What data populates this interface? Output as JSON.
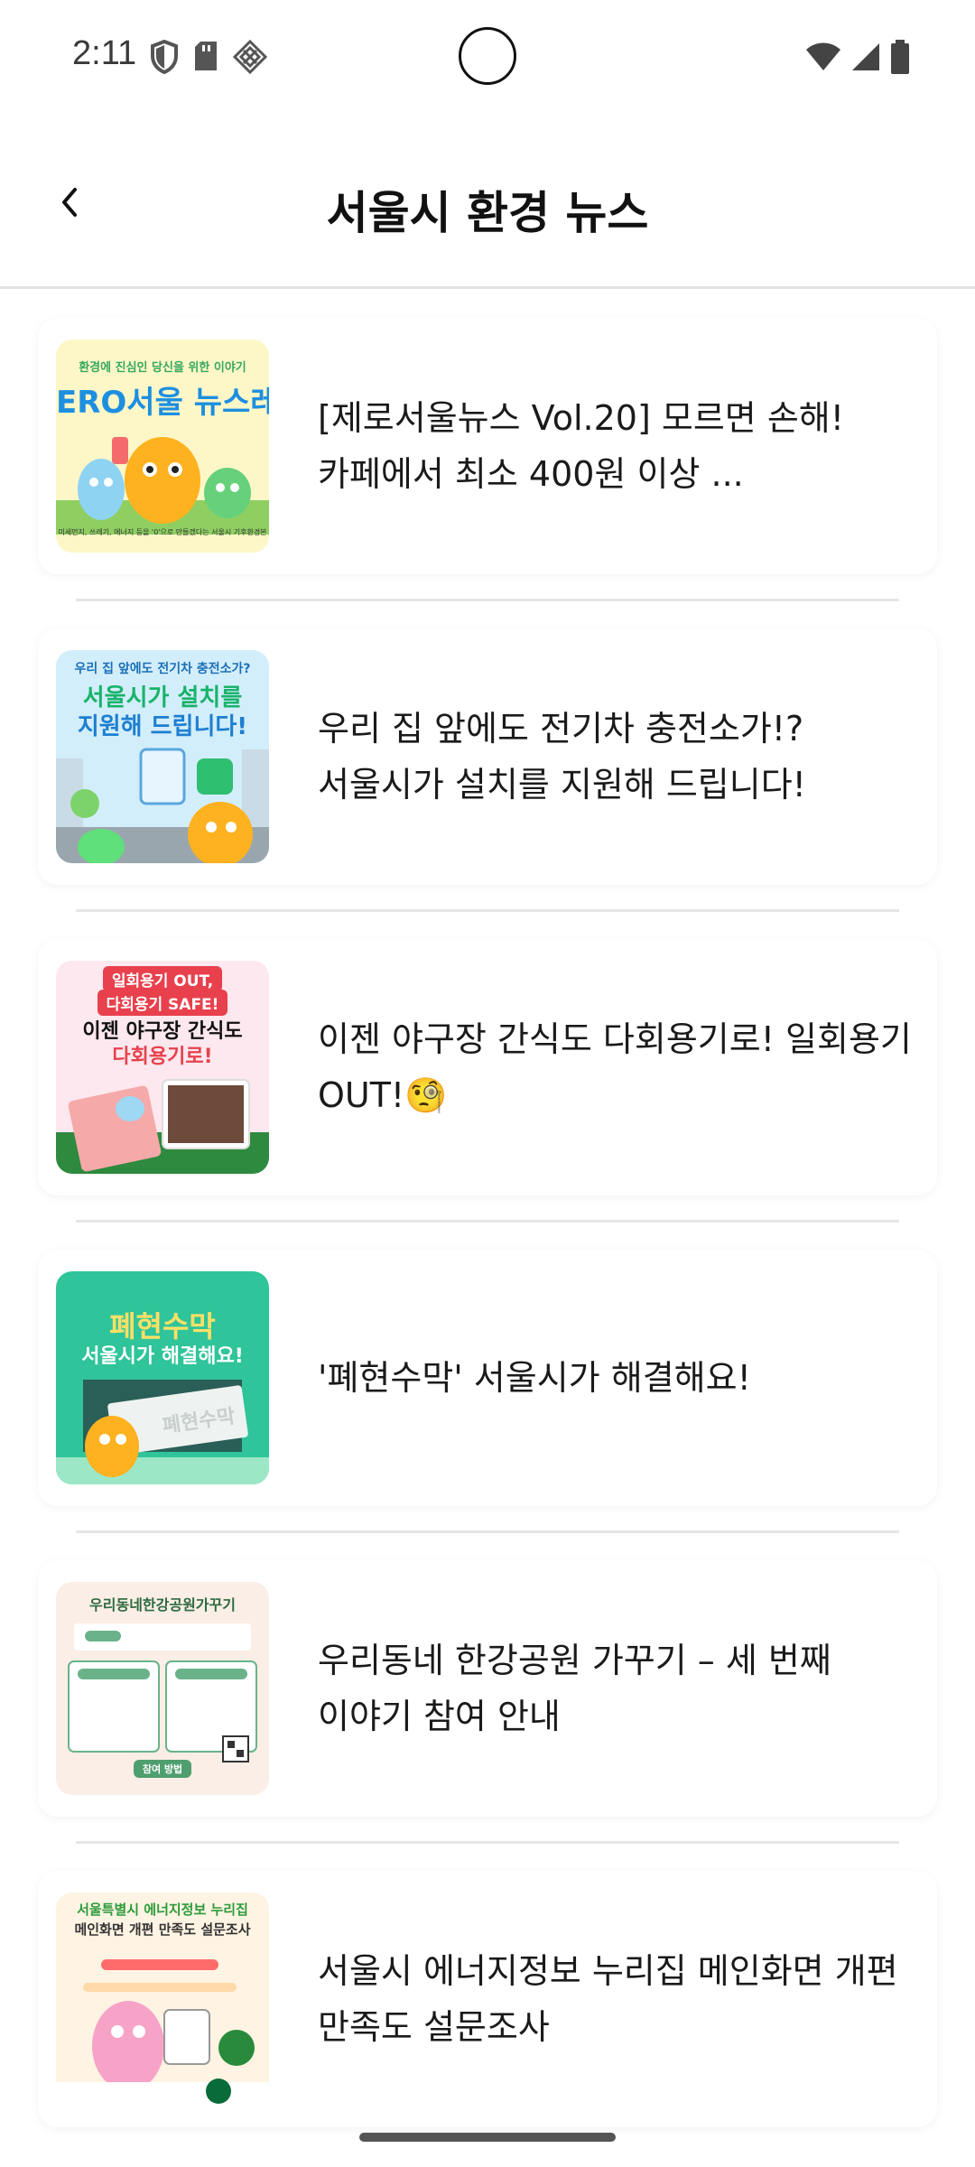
{
  "status": {
    "time": "2:11",
    "left_icons": [
      "shield-icon",
      "sd-card-icon",
      "app-notification-icon"
    ],
    "right_icons": [
      "wifi-icon",
      "cell-signal-icon",
      "battery-icon"
    ]
  },
  "header": {
    "title": "서울시 환경 뉴스",
    "back_icon": "back-chevron-icon"
  },
  "news": [
    {
      "title": "[제로서울뉴스 Vol.20] 모르면 손해! 카페에서 최소 400원 이상 ...",
      "thumb": {
        "top": "환경에 진심인 당신을 위한 이야기",
        "main": "ERO서울 뉴스레",
        "bottom": "미세먼지, 쓰레기, 에너지 등을 '0'으로 만들겠다는 서울시 기후환경본"
      }
    },
    {
      "title": "우리 집 앞에도 전기차 충전소가!? 서울시가 설치를 지원해 드립니다!",
      "thumb": {
        "top": "우리 집 앞에도 전기차 충전소가?",
        "line1": "서울시가 설치를",
        "line2": "지원해 드립니다!"
      }
    },
    {
      "title": "이젠 야구장 간식도 다회용기로! 일회용기 OUT!🧐",
      "thumb": {
        "pill1": "일회용기 OUT,",
        "pill2": "다회용기 SAFE!",
        "line1": "이젠 야구장 간식도",
        "line2": "다회용기로!"
      }
    },
    {
      "title": "'폐현수막' 서울시가 해결해요!",
      "thumb": {
        "line1": "폐현수막",
        "line2": "서울시가 해결해요!",
        "banner": "폐현수막"
      }
    },
    {
      "title": "우리동네 한강공원 가꾸기 – 세 번째 이야기 참여 안내",
      "thumb": {
        "top": "우리동네한강공원가꾸기",
        "btn": "참여 방법"
      }
    },
    {
      "title": "서울시 에너지정보 누리집 메인화면 개편 만족도 설문조사",
      "thumb": {
        "line1": "서울특별시 에너지정보 누리집",
        "line2": "메인화면 개편 만족도 설문조사"
      }
    }
  ],
  "colors": {
    "divider": "#e6e6e6",
    "title": "#111111"
  }
}
